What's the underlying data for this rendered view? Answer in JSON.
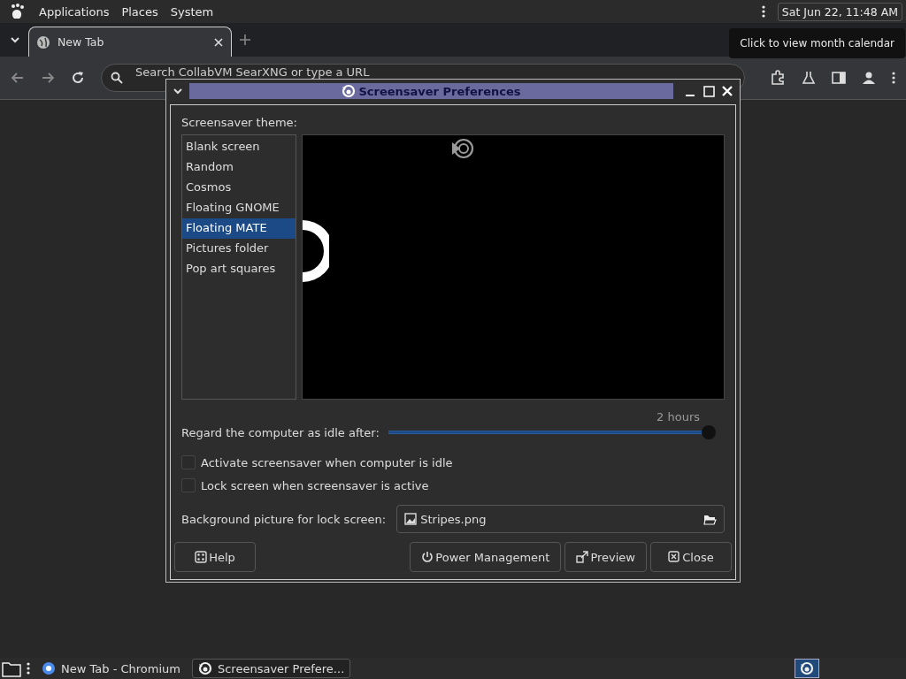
{
  "top_panel": {
    "menus": [
      "Applications",
      "Places",
      "System"
    ],
    "clock": "Sat Jun 22, 11:48 AM",
    "tooltip": "Click to view month calendar"
  },
  "browser": {
    "tabs": [
      {
        "label": "New Tab",
        "selected": true
      }
    ],
    "omnibox": {
      "placeholder": "Search CollabVM SearXNG or type a URL"
    }
  },
  "dialog": {
    "title": "Screensaver Preferences",
    "theme_label": "Screensaver theme:",
    "themes": [
      {
        "label": "Blank screen",
        "selected": false
      },
      {
        "label": "Random",
        "selected": false
      },
      {
        "label": "Cosmos",
        "selected": false
      },
      {
        "label": "Floating GNOME",
        "selected": false
      },
      {
        "label": "Floating MATE",
        "selected": true
      },
      {
        "label": "Pictures folder",
        "selected": false
      },
      {
        "label": "Pop art squares",
        "selected": false
      }
    ],
    "idle": {
      "label": "Regard the computer as idle after:",
      "reading": "2 hours",
      "level": 1.0
    },
    "checkboxes": [
      {
        "label": "Activate screensaver when computer is idle",
        "checked": false
      },
      {
        "label": "Lock screen when screensaver is active",
        "checked": false
      }
    ],
    "lock_background": {
      "label": "Background picture for lock screen:",
      "file": "Stripes.png"
    },
    "buttons": [
      {
        "label": "Help",
        "kind": "help"
      },
      {
        "label": "Power Management",
        "kind": "power"
      },
      {
        "label": "Preview",
        "kind": "preview"
      },
      {
        "label": "Close",
        "kind": "close"
      }
    ]
  },
  "taskbar": {
    "items": [
      {
        "label": "New Tab - Chromium",
        "selected": false
      },
      {
        "label": "Screensaver Prefere...",
        "selected": true
      }
    ]
  }
}
